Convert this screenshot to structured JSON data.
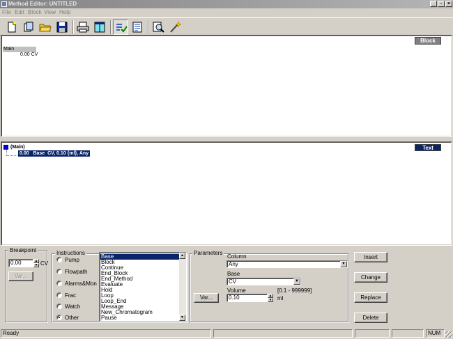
{
  "window": {
    "title": "Method Editor: UNTITLED"
  },
  "menu": [
    "File",
    "Edit",
    "Block",
    "View",
    "Help"
  ],
  "toolbar": {
    "buttons": [
      "new-icon",
      "open-icon",
      "folder-icon",
      "save-icon",
      "print-icon",
      "window-icon",
      "check-icon",
      "list-icon",
      "zoom-icon",
      "wand-icon"
    ]
  },
  "block_pane": {
    "tag": "Block",
    "main_label": "Main",
    "main_value": "0.00 CV"
  },
  "text_pane": {
    "tag": "Text",
    "root": "(Main)",
    "line": "0.00   Base  CV, 0.10 {ml}, Any"
  },
  "breakpoint": {
    "label": "Breakpoint",
    "value": "0.00",
    "unit": "CV",
    "var_button": "Var..."
  },
  "instructions": {
    "label": "Instructions",
    "radios": [
      "Pump",
      "Flowpath",
      "Alarms&Mon",
      "Frac",
      "Watch",
      "Other"
    ],
    "selected_radio": "Other",
    "list": [
      "Base",
      "Block",
      "Continue",
      "End_Block",
      "End_Method",
      "Evaluate",
      "Hold",
      "Loop",
      "Loop_End",
      "Message",
      "New_Chromatogram",
      "Pause"
    ],
    "selected_item": "Base"
  },
  "parameters": {
    "label": "Parameters",
    "var_button": "Var...",
    "column_label": "Column",
    "column_value": "Any",
    "base_label": "Base",
    "base_value": "CV",
    "volume_label": "Volume",
    "volume_range": "[0.1 - 999999]",
    "volume_value": "0.10",
    "volume_unit": "ml"
  },
  "actions": [
    "Insert",
    "Change",
    "Replace",
    "Delete"
  ],
  "status": {
    "text": "Ready",
    "num": "NUM"
  },
  "colors": {
    "selection": "#0a246a",
    "face": "#d4d0c8"
  }
}
